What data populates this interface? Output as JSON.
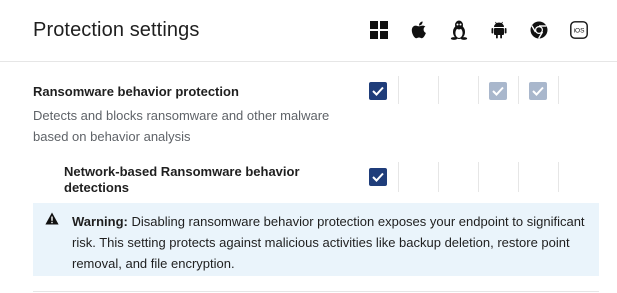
{
  "header": {
    "title": "Protection settings",
    "platform_icons": [
      "windows-icon",
      "apple-icon",
      "linux-icon",
      "android-icon",
      "chrome-icon",
      "ios-icon"
    ],
    "ios_label": "iOS"
  },
  "settings": [
    {
      "title": "Ransomware behavior protection",
      "description": "Detects and blocks ransomware and other malware based on behavior analysis",
      "platforms": {
        "windows": "checked",
        "apple": "none",
        "linux": "none",
        "android": "checked-disabled",
        "chrome": "checked-disabled",
        "ios": "none"
      }
    },
    {
      "title": "Network-based Ransomware behavior detections",
      "platforms": {
        "windows": "checked",
        "apple": "none",
        "linux": "none",
        "android": "none",
        "chrome": "none",
        "ios": "none"
      }
    }
  ],
  "warning": {
    "label": "Warning:",
    "text": " Disabling ransomware behavior protection exposes your endpoint to significant risk. This setting protects against malicious activities like backup deletion, restore point removal, and file encryption."
  },
  "colors": {
    "checkbox_checked": "#1f3d7a",
    "checkbox_disabled": "#a9b7cc",
    "warning_background": "#eaf4fb"
  }
}
